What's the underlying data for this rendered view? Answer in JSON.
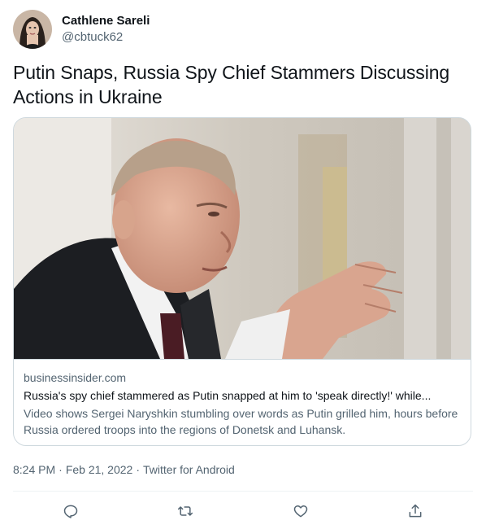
{
  "author": {
    "display_name": "Cathlene Sareli",
    "handle": "@cbtuck62"
  },
  "tweet": {
    "text": "Putin Snaps, Russia Spy Chief Stammers Discussing Actions in Ukraine"
  },
  "card": {
    "domain": "businessinsider.com",
    "title": "Russia's spy chief stammered as Putin snapped at him to 'speak directly!' while...",
    "description": "Video shows Sergei Naryshkin stumbling over words as Putin grilled him, hours before Russia ordered troops into the regions of Donetsk and Luhansk."
  },
  "meta": {
    "time": "8:24 PM",
    "date": "Feb 21, 2022",
    "source": "Twitter for Android",
    "separator": "·"
  },
  "icons": {
    "reply": "reply-icon",
    "retweet": "retweet-icon",
    "like": "like-icon",
    "share": "share-icon"
  },
  "colors": {
    "text_primary": "#0f1419",
    "text_secondary": "#536471",
    "border": "#cfd9de"
  }
}
